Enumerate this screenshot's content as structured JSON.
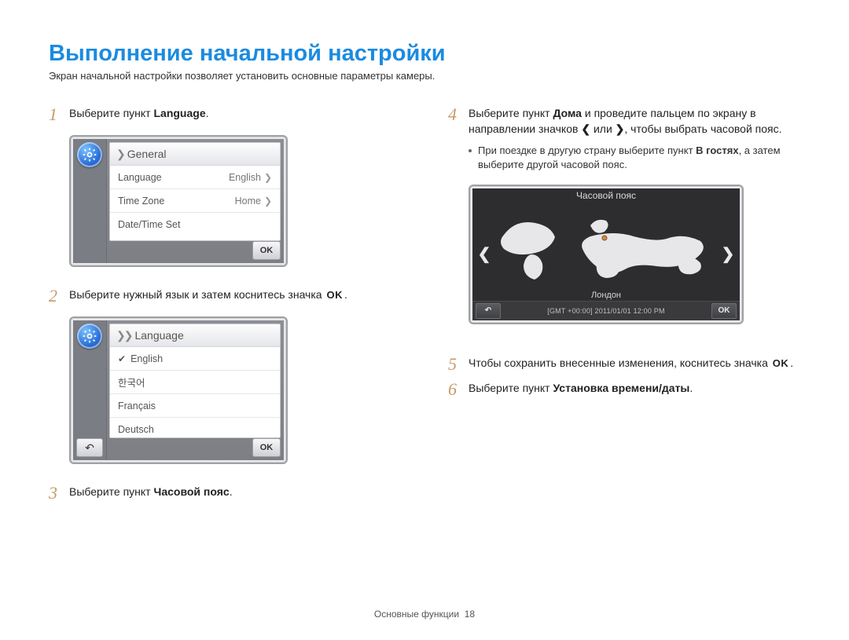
{
  "page": {
    "title": "Выполнение начальной настройки",
    "subtitle": "Экран начальной настройки позволяет установить основные параметры камеры.",
    "footer_section": "Основные функции",
    "footer_page": "18"
  },
  "steps": {
    "s1_num": "1",
    "s1_a": "Выберите пункт ",
    "s1_b": "Language",
    "s1_c": ".",
    "s2_num": "2",
    "s2_a": "Выберите нужный язык и затем коснитесь значка ",
    "s2_ok": "OK",
    "s2_c": ".",
    "s3_num": "3",
    "s3_a": "Выберите пункт ",
    "s3_b": "Часовой пояс",
    "s3_c": ".",
    "s4_num": "4",
    "s4_a": "Выберите пункт ",
    "s4_b": "Дома",
    "s4_c": " и проведите пальцем по экрану в направлении значков ",
    "s4_d": " или ",
    "s4_e": ", чтобы выбрать часовой пояс.",
    "s4_note_a": "При поездке в другую страну выберите пункт ",
    "s4_note_b": "В гостях",
    "s4_note_c": ", а затем выберите другой часовой пояс.",
    "s5_num": "5",
    "s5_a": "Чтобы сохранить внесенные изменения, коснитесь значка ",
    "s5_ok": "OK",
    "s5_c": ".",
    "s6_num": "6",
    "s6_a": "Выберите пункт ",
    "s6_b": "Установка времени/даты",
    "s6_c": "."
  },
  "generalPanel": {
    "head": "General",
    "row_language_label": "Language",
    "row_language_value": "English",
    "row_timezone_label": "Time Zone",
    "row_timezone_value": "Home",
    "row_datetime_label": "Date/Time Set",
    "ok": "OK"
  },
  "languagePanel": {
    "head": "Language",
    "opt_english": "English",
    "opt_korean": "한국어",
    "opt_french": "Français",
    "opt_german": "Deutsch",
    "ok": "OK"
  },
  "timezonePanel": {
    "head": "Часовой пояс",
    "city": "Лондон",
    "gmt": "[GMT +00:00] 2011/01/01 12:00 PM",
    "ok": "OK"
  }
}
